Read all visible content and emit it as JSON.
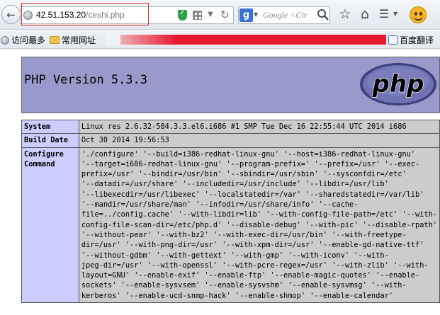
{
  "browser": {
    "url_host": "42.51.153.20",
    "url_path": "/ceshi.php",
    "search_engine_letter": "g",
    "search_placeholder": "Google <Ctr"
  },
  "bookmarks": [
    {
      "label": "访问最多",
      "icon": "globe-icon"
    },
    {
      "label": "常用网址",
      "icon": "folder-icon"
    },
    {
      "label": "百度翻译",
      "icon": "translate-icon"
    }
  ],
  "page": {
    "title": "PHP Version 5.3.3",
    "logo_text": "php",
    "rows": [
      {
        "label": "System",
        "value": "Linux res 2.6.32-504.3.3.el6.i686 #1 SMP Tue Dec 16 22:55:44 UTC 2014 i686"
      },
      {
        "label": "Build Date",
        "value": "Oct 30 2014 19:56:53"
      },
      {
        "label": "Configure\nCommand",
        "value": "'./configure' '--build=i386-redhat-linux-gnu' '--host=i386-redhat-linux-gnu'\n'--target=i686-redhat-linux-gnu' '--program-prefix=' '--prefix=/usr' '--exec-\nprefix=/usr' '--bindir=/usr/bin' '--sbindir=/usr/sbin' '--sysconfdir=/etc'\n'--datadir=/usr/share' '--includedir=/usr/include' '--libdir=/usr/lib'\n'--libexecdir=/usr/libexec' '--localstatedir=/var' '--sharedstatedir=/var/lib'\n'--mandir=/usr/share/man' '--infodir=/usr/share/info' '--cache-\nfile=../config.cache' '--with-libdir=lib' '--with-config-file-path=/etc' '--with-\nconfig-file-scan-dir=/etc/php.d' '--disable-debug' '--with-pic' '--disable-rpath'\n'--without-pear' '--with-bz2' '--with-exec-dir=/usr/bin' '--with-freetype-\ndir=/usr' '--with-png-dir=/usr' '--with-xpm-dir=/usr' '--enable-gd-native-ttf'\n'--without-gdbm' '--with-gettext' '--with-gmp' '--with-iconv' '--with-\njpeg-dir=/usr' '--with-openssl' '--with-pcre-regex=/usr' '--with-zlib' '--with-\nlayout=GNU' '--enable-exif' '--enable-ftp' '--enable-magic-quotes' '--enable-\nsockets' '--enable-sysvsem' '--enable-sysvshm' '--enable-sysvmsg' '--with-\nkerberos' '--enable-ucd-snmp-hack' '--enable-shmop' '--enable-calendar'\n'--without-sqlite' '--with-libxml-dir=/usr' '--enable-xml' '--with-system-tzdata'"
      }
    ]
  }
}
